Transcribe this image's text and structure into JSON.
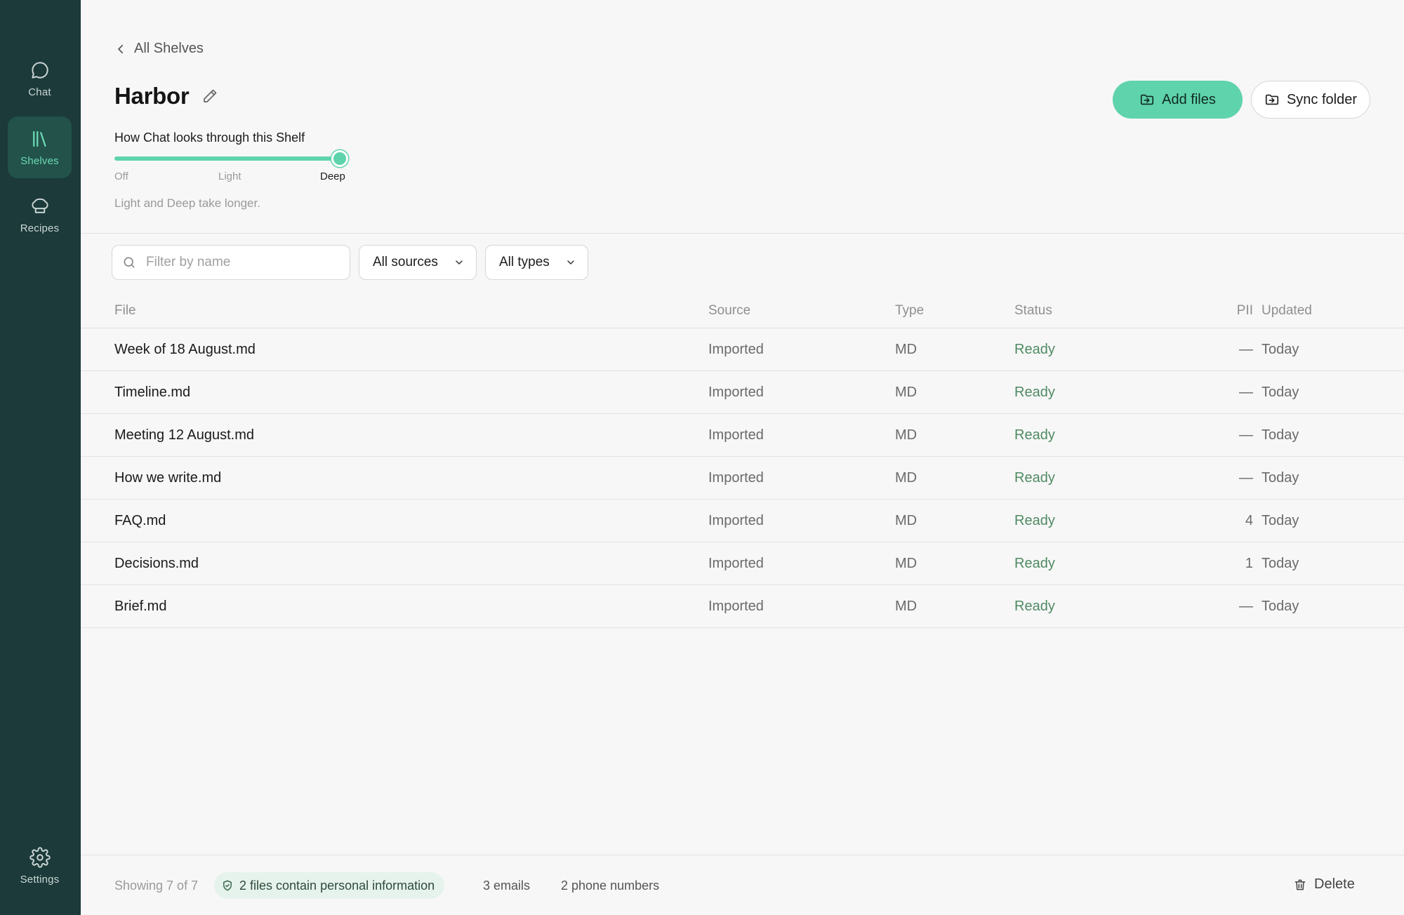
{
  "sidebar": {
    "items": [
      {
        "label": "Chat",
        "icon": "chat-bubble-icon"
      },
      {
        "label": "Shelves",
        "icon": "library-icon",
        "active": true
      },
      {
        "label": "Recipes",
        "icon": "chef-hat-icon"
      }
    ],
    "settings": {
      "label": "Settings",
      "icon": "gear-icon"
    }
  },
  "header": {
    "back_label": "All Shelves",
    "title": "Harbor",
    "add_files_label": "Add files",
    "sync_folder_label": "Sync folder"
  },
  "depth": {
    "title": "How Chat looks through this Shelf",
    "stops": [
      "Off",
      "Light",
      "Deep"
    ],
    "selected": "Deep",
    "hint": "Light and Deep take longer."
  },
  "filters": {
    "search_placeholder": "Filter by name",
    "search_value": "",
    "sources_value": "All sources",
    "types_value": "All types"
  },
  "table": {
    "columns": {
      "file": "File",
      "source": "Source",
      "type": "Type",
      "status": "Status",
      "pii": "PII",
      "updated": "Updated"
    },
    "rows": [
      {
        "file": "Week of 18 August.md",
        "source": "Imported",
        "type": "MD",
        "status": "Ready",
        "pii": "—",
        "updated": "Today"
      },
      {
        "file": "Timeline.md",
        "source": "Imported",
        "type": "MD",
        "status": "Ready",
        "pii": "—",
        "updated": "Today"
      },
      {
        "file": "Meeting 12 August.md",
        "source": "Imported",
        "type": "MD",
        "status": "Ready",
        "pii": "—",
        "updated": "Today"
      },
      {
        "file": "How we write.md",
        "source": "Imported",
        "type": "MD",
        "status": "Ready",
        "pii": "—",
        "updated": "Today"
      },
      {
        "file": "FAQ.md",
        "source": "Imported",
        "type": "MD",
        "status": "Ready",
        "pii": "4",
        "updated": "Today"
      },
      {
        "file": "Decisions.md",
        "source": "Imported",
        "type": "MD",
        "status": "Ready",
        "pii": "1",
        "updated": "Today"
      },
      {
        "file": "Brief.md",
        "source": "Imported",
        "type": "MD",
        "status": "Ready",
        "pii": "—",
        "updated": "Today"
      }
    ]
  },
  "footer": {
    "showing": "Showing 7 of 7",
    "pii_summary": "2 files contain personal information",
    "emails": "3 emails",
    "phones": "2 phone numbers",
    "delete_label": "Delete"
  },
  "colors": {
    "sidebar_bg": "#1c3a3a",
    "accent": "#5fd3ab",
    "status_ready": "#4f8a63"
  }
}
